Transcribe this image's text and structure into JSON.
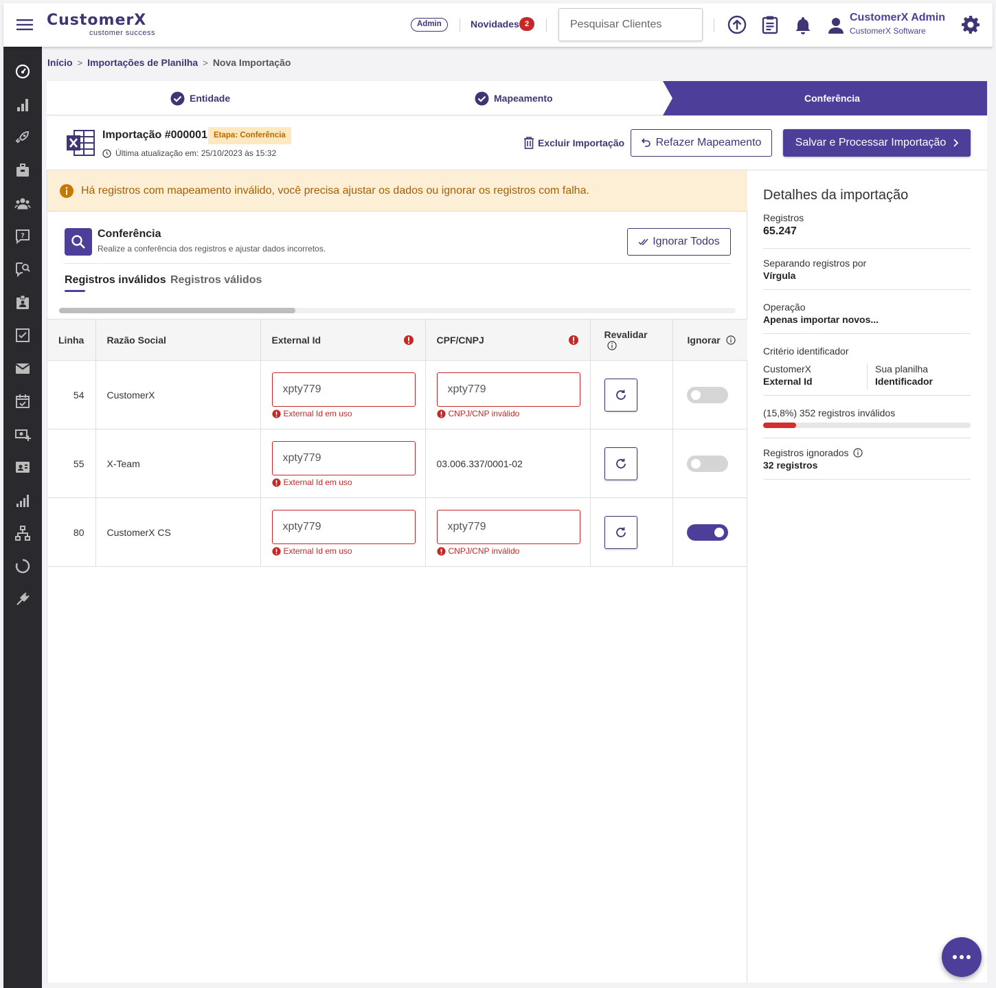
{
  "topbar": {
    "logo_text": "CustomerX",
    "logo_subtitle": "customer success",
    "role_badge": "Admin",
    "news_label": "Novidades",
    "news_count": "2",
    "search_placeholder": "Pesquisar Clientes",
    "user_name": "CustomerX Admin",
    "user_company": "CustomerX Software",
    "icons": [
      "menu-icon",
      "upload-icon",
      "clipboard-icon",
      "bell-icon",
      "user-icon",
      "gear-icon"
    ]
  },
  "sidebar": {
    "icons": [
      "dashboard-icon",
      "bar-chart-icon",
      "rocket-icon",
      "briefcase-icon",
      "users-icon",
      "help-chat-icon",
      "search-chat-icon",
      "contact-badge-icon",
      "checklist-icon",
      "mail-icon",
      "calendar-check-icon",
      "money-add-icon",
      "id-card-icon",
      "signal-bars-icon",
      "sitemap-icon",
      "refresh-circle-icon",
      "plug-icon"
    ]
  },
  "breadcrumb": {
    "items": [
      "Início",
      "Importações de Planilha",
      "Nova Importação"
    ]
  },
  "stepper": {
    "steps": [
      {
        "label": "Entidade",
        "status": "done"
      },
      {
        "label": "Mapeamento",
        "status": "done"
      },
      {
        "label": "Conferência",
        "status": "active"
      }
    ]
  },
  "import_header": {
    "title": "Importação #000001",
    "stage_badge": "Etapa: Conferência",
    "updated": "Última atualização em: 25/10/2023 às 15:32",
    "delete_label": "Excluir Importação",
    "remap_label": "Refazer Mapeamento",
    "save_label": "Salvar e Processar Importação"
  },
  "alert": {
    "text": "Há registros com mapeamento inválido, você precisa ajustar os dados ou ignorar os registros com falha."
  },
  "conferencia": {
    "title": "Conferência",
    "subtitle": "Realize a conferência dos registros e ajustar dados incorretos.",
    "ignore_all_label": "Ignorar Todos",
    "tabs": [
      "Registros inválidos",
      "Registros válidos"
    ],
    "columns": [
      "Linha",
      "Razão Social",
      "External Id",
      "CPF/CNPJ",
      "Revalidar",
      "Ignorar"
    ],
    "rows": [
      {
        "line": "54",
        "name": "CustomerX",
        "external_id": "xpty779",
        "external_id_error": "External Id em uso",
        "cnpj": "xpty779",
        "cnpj_error": "CNPJ/CNP inválido",
        "ignored": false
      },
      {
        "line": "55",
        "name": "X-Team",
        "external_id": "xpty779",
        "external_id_error": "External Id em uso",
        "cnpj_text": "03.006.337/0001-02",
        "ignored": false
      },
      {
        "line": "80",
        "name": "CustomerX CS",
        "external_id": "xpty779",
        "external_id_error": "External Id em uso",
        "cnpj": "xpty779",
        "cnpj_error": "CNPJ/CNP inválido",
        "ignored": true
      }
    ]
  },
  "details": {
    "title": "Detalhes da importação",
    "records_label": "Registros",
    "records_value": "65.247",
    "separator_label": "Separando registros por",
    "separator_value": "Vírgula",
    "operation_label": "Operação",
    "operation_value": "Apenas importar novos...",
    "criterion_label": "Critério identificador",
    "criterion_left_label": "CustomerX",
    "criterion_left_value": "External Id",
    "criterion_right_label": "Sua planilha",
    "criterion_right_value": "Identificador",
    "invalid_text": "(15,8%) 352 registros inválidos",
    "invalid_fraction": 0.158,
    "ignored_label": "Registros ignorados",
    "ignored_value": "32 registros"
  },
  "colors": {
    "brand": "#4d3e99",
    "error": "#c62828",
    "warning_bg": "#fdefd6",
    "sidebar": "#29292e"
  }
}
